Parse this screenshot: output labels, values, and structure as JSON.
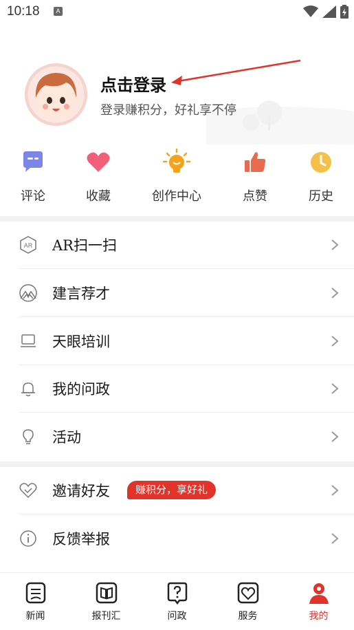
{
  "status_bar": {
    "time": "10:18",
    "notification_badge": "A"
  },
  "profile": {
    "login_title": "点击登录",
    "login_subtitle": "登录赚积分，好礼享不停",
    "accent_color": "#e2332a"
  },
  "quick_actions": [
    {
      "label": "评论",
      "icon": "comment-icon",
      "color": "#7c86e6"
    },
    {
      "label": "收藏",
      "icon": "heart-icon",
      "color": "#f0607b"
    },
    {
      "label": "创作中心",
      "icon": "lightbulb-icon",
      "color": "#f7a21b"
    },
    {
      "label": "点赞",
      "icon": "thumbs-up-icon",
      "color": "#ea6a4f"
    },
    {
      "label": "历史",
      "icon": "clock-icon",
      "color": "#f4c04a"
    }
  ],
  "menu_group_1": [
    {
      "label": "AR扫一扫",
      "icon": "ar-scan-icon"
    },
    {
      "label": "建言荐才",
      "icon": "mountain-icon"
    },
    {
      "label": "天眼培训",
      "icon": "laptop-icon"
    },
    {
      "label": "我的问政",
      "icon": "bell-icon"
    },
    {
      "label": "活动",
      "icon": "lightbulb-outline-icon"
    }
  ],
  "menu_group_2": [
    {
      "label": "邀请好友",
      "icon": "heart-outline-icon",
      "badge": "赚积分，享好礼"
    },
    {
      "label": "反馈举报",
      "icon": "info-icon"
    }
  ],
  "tab_bar": [
    {
      "label": "新闻",
      "icon": "news-icon",
      "active": false
    },
    {
      "label": "报刊汇",
      "icon": "book-icon",
      "active": false
    },
    {
      "label": "问政",
      "icon": "question-icon",
      "active": false
    },
    {
      "label": "服务",
      "icon": "service-heart-icon",
      "active": false
    },
    {
      "label": "我的",
      "icon": "person-icon",
      "active": true
    }
  ]
}
